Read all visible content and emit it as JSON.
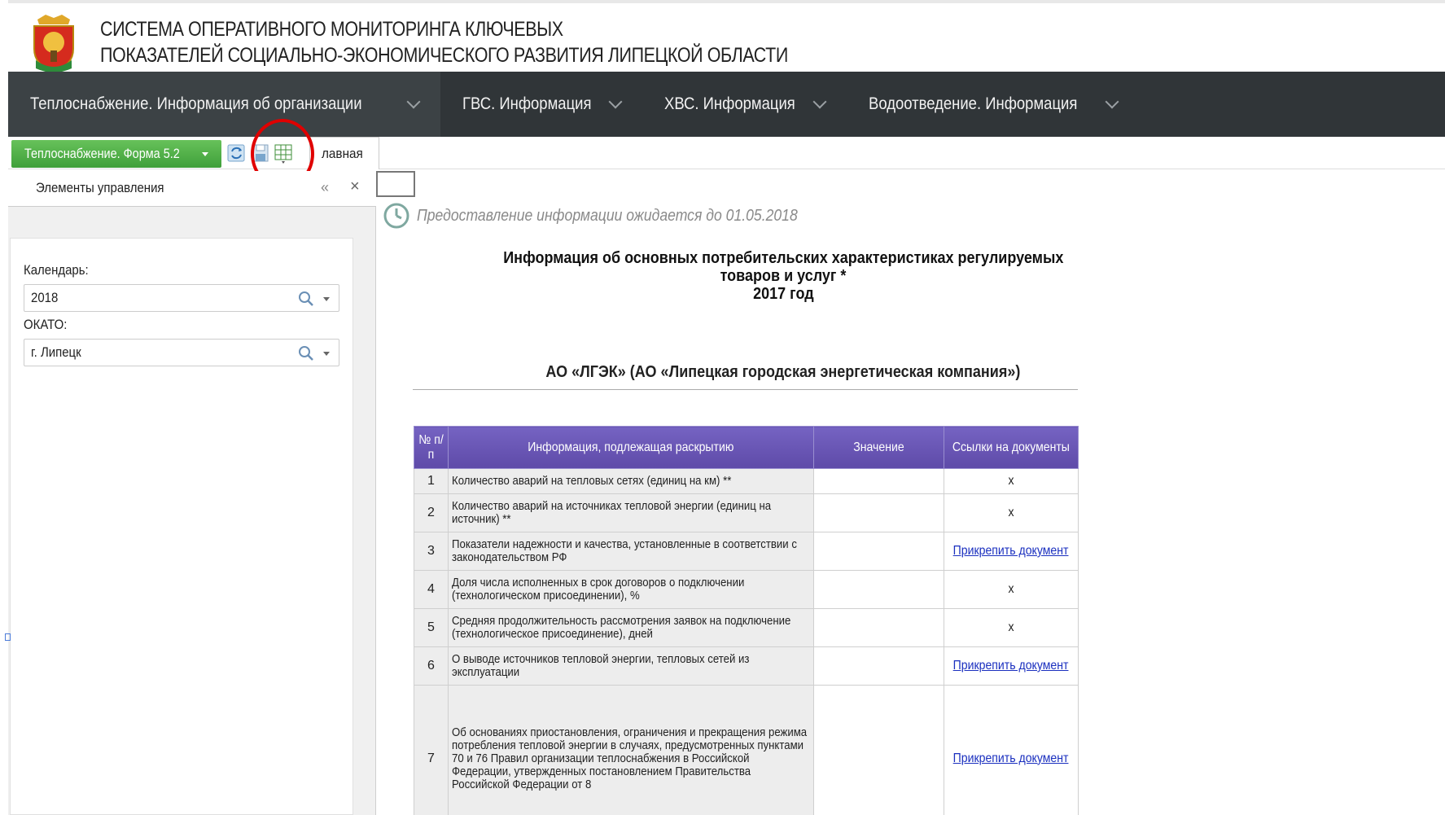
{
  "header": {
    "title_line1": "СИСТЕМА ОПЕРАТИВНОГО МОНИТОРИНГА КЛЮЧЕВЫХ",
    "title_line2": "ПОКАЗАТЕЛЕЙ СОЦИАЛЬНО-ЭКОНОМИЧЕСКОГО РАЗВИТИЯ ЛИПЕЦКОЙ ОБЛАСТИ",
    "logo_icon": "coat-of-arms-icon"
  },
  "topnav": {
    "items": [
      {
        "label": "Теплоснабжение. Информация об организации",
        "active": true
      },
      {
        "label": "ГВС. Информация",
        "active": false
      },
      {
        "label": "ХВС. Информация",
        "active": false
      },
      {
        "label": "Водоотведение. Информация",
        "active": false
      }
    ]
  },
  "subbar": {
    "form_selector": "Теплоснабжение. Форма 5.2",
    "tab_main": "лавная",
    "icons": [
      "refresh-icon",
      "save-icon",
      "table-export-icon"
    ]
  },
  "left_panel": {
    "title": "Элементы управления",
    "collapse_glyph": "«",
    "close_glyph": "×",
    "calendar_label": "Календарь:",
    "calendar_value": "2018",
    "okato_label": "ОКАТО:",
    "okato_value": "г. Липецк"
  },
  "main": {
    "notice": "Предоставление информации ожидается до 01.05.2018",
    "heading_line1": "Информация об основных потребительских характеристиках регулируемых",
    "heading_line2": "товаров и услуг *",
    "heading_line3": "2017 год",
    "org_name": "АО «ЛГЭК» (АО «Липецкая городская энергетическая компания»)",
    "table": {
      "headers": [
        "№ п/п",
        "Информация, подлежащая раскрытию",
        "Значение",
        "Ссылки на документы"
      ],
      "rows": [
        {
          "num": "1",
          "info": "Количество аварий на тепловых сетях (единиц на км) **",
          "value": "",
          "link": "x"
        },
        {
          "num": "2",
          "info": "Количество аварий на источниках тепловой энергии (единиц на источник) **",
          "value": "",
          "link": "x"
        },
        {
          "num": "3",
          "info": "Показатели надежности и качества, установленные в соответствии с законодательством РФ",
          "value": "",
          "link": "Прикрепить документ"
        },
        {
          "num": "4",
          "info": "Доля числа исполненных в срок договоров о подключении (технологическом присоединении), %",
          "value": "",
          "link": "x"
        },
        {
          "num": "5",
          "info": "Средняя продолжительность рассмотрения заявок на подключение (технологическое присоединение), дней",
          "value": "",
          "link": "x"
        },
        {
          "num": "6",
          "info": "О выводе источников тепловой энергии, тепловых сетей из эксплуатации",
          "value": "",
          "link": "Прикрепить документ"
        },
        {
          "num": "7",
          "info": "Об основаниях приостановления, ограничения и прекращения режима потребления тепловой энергии в случаях, предусмотренных пунктами 70 и 76 Правил организации теплоснабжения в Российской Федерации, утвержденных постановлением Правительства Российской Федерации от 8",
          "value": "",
          "link": "Прикрепить документ"
        }
      ]
    }
  },
  "colors": {
    "nav_bg": "#303538",
    "form_button": "#4caf50",
    "table_header": "#6a55b5",
    "highlight": "#e00000",
    "link": "#1a2fbf"
  }
}
